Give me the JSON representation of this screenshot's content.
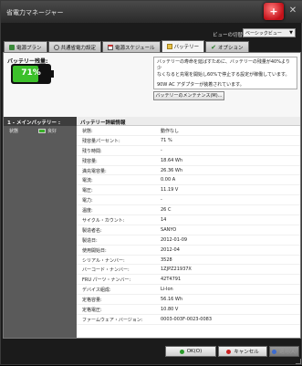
{
  "window": {
    "title": "省電力マネージャー",
    "close_glyph": "✕",
    "app_icon_glyph": "+"
  },
  "view": {
    "label": "ビューの切替:",
    "value": "ベーシックビュー"
  },
  "tabs": [
    {
      "label": "電源プラン",
      "icon": "plug-icon"
    },
    {
      "label": "共通省電力設定",
      "icon": "gear-icon"
    },
    {
      "label": "電源スケジュール",
      "icon": "calendar-icon"
    },
    {
      "label": "バッテリー",
      "icon": "folder-icon"
    },
    {
      "label": "オプション",
      "icon": "check-icon"
    }
  ],
  "battery": {
    "label": "バッテリー残量:",
    "percent_text": "71%",
    "level": 0.71,
    "fill_color": "#3cc02a"
  },
  "info": {
    "line1": "バッテリーの寿命を延ばすために、バッテリーの残量が40%より少",
    "line2": "なくなると充電を開始し60%で停止する設定が稼働しています。",
    "line3": "90W AC アダプターが装着されています。"
  },
  "maintenance_button": "バッテリーのメンテナンス(M)...",
  "sidebar": {
    "heading": "1 - メインバッテリー :",
    "status_label": "状態",
    "status_value": "良好"
  },
  "details": {
    "heading": "バッテリー詳細情報",
    "rows": [
      {
        "k": "状態:",
        "v": "動作なし"
      },
      {
        "k": "残容量パーセント:",
        "v": "71 %"
      },
      {
        "k": "残り時間:",
        "v": "-"
      },
      {
        "k": "残容量:",
        "v": "18.64 Wh"
      },
      {
        "k": "満充電容量:",
        "v": "26.36 Wh"
      },
      {
        "k": "電流:",
        "v": "0.00 A"
      },
      {
        "k": "電圧:",
        "v": "11.19 V"
      },
      {
        "k": "電力:",
        "v": "-"
      },
      {
        "k": "温度:",
        "v": "26 C"
      },
      {
        "k": "サイクル・カウント:",
        "v": "14"
      },
      {
        "k": "製造者名:",
        "v": "SANYO"
      },
      {
        "k": "製造日:",
        "v": "2012-01-09"
      },
      {
        "k": "使用開始日:",
        "v": "2012-04"
      },
      {
        "k": "シリアル・ナンバー:",
        "v": "3528"
      },
      {
        "k": "バーコード・ナンバー:",
        "v": "1ZJPZ21937X"
      },
      {
        "k": "FRU パーツ・ナンバー:",
        "v": "42T4791"
      },
      {
        "k": "デバイス組成:",
        "v": "Li-Ion"
      },
      {
        "k": "定格容量:",
        "v": "56.16 Wh"
      },
      {
        "k": "定格電圧:",
        "v": "10.80 V"
      },
      {
        "k": "ファームウェア・バージョン:",
        "v": "0003-003F-0023-0083"
      }
    ]
  },
  "footer": {
    "ok": "OK(O)",
    "cancel": "キャンセル",
    "apply": "適用(A)"
  }
}
